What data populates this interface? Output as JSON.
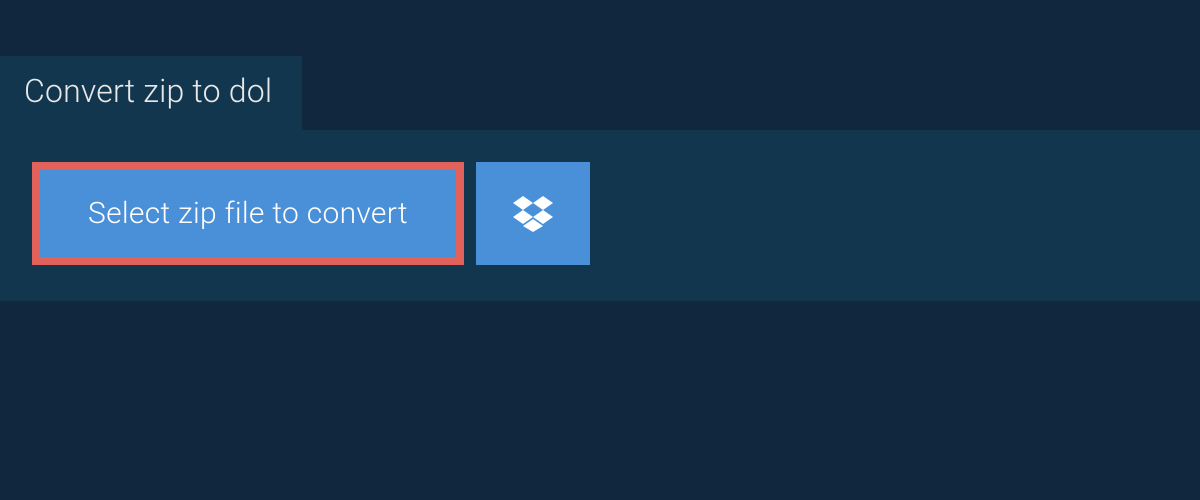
{
  "tab": {
    "title": "Convert zip to dol"
  },
  "actions": {
    "select_label": "Select zip file to convert",
    "dropbox_aria": "Select from Dropbox"
  },
  "colors": {
    "bg": "#11273e",
    "panel": "#13364f",
    "button": "#4a90d9",
    "highlight_border": "#e1625a",
    "text": "#ffffff"
  }
}
